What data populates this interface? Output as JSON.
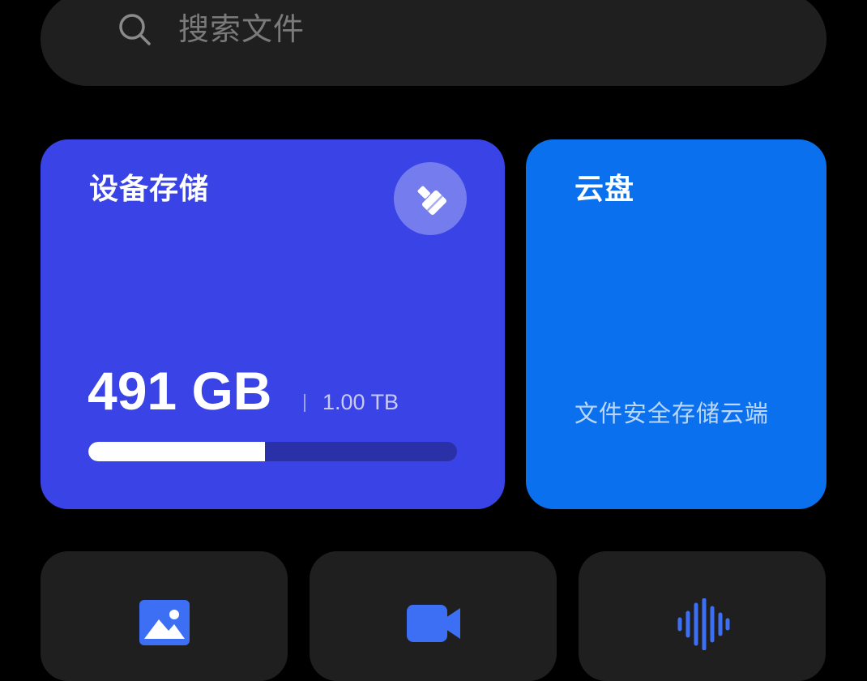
{
  "search": {
    "placeholder": "搜索文件",
    "icon": "search-icon"
  },
  "device_storage": {
    "title": "设备存储",
    "used": "491 GB",
    "total": "1.00 TB",
    "used_fraction": 0.479,
    "clean_icon": "broom-icon",
    "color": "#3a44e6"
  },
  "cloud": {
    "title": "云盘",
    "description": "文件安全存储云端",
    "color": "#0a70ee"
  },
  "categories": [
    {
      "icon": "image-icon"
    },
    {
      "icon": "video-camera-icon"
    },
    {
      "icon": "audio-waveform-icon"
    }
  ],
  "colors": {
    "background": "#000000",
    "surface": "#1f1f1f",
    "accent_icon": "#3d6ff5"
  }
}
